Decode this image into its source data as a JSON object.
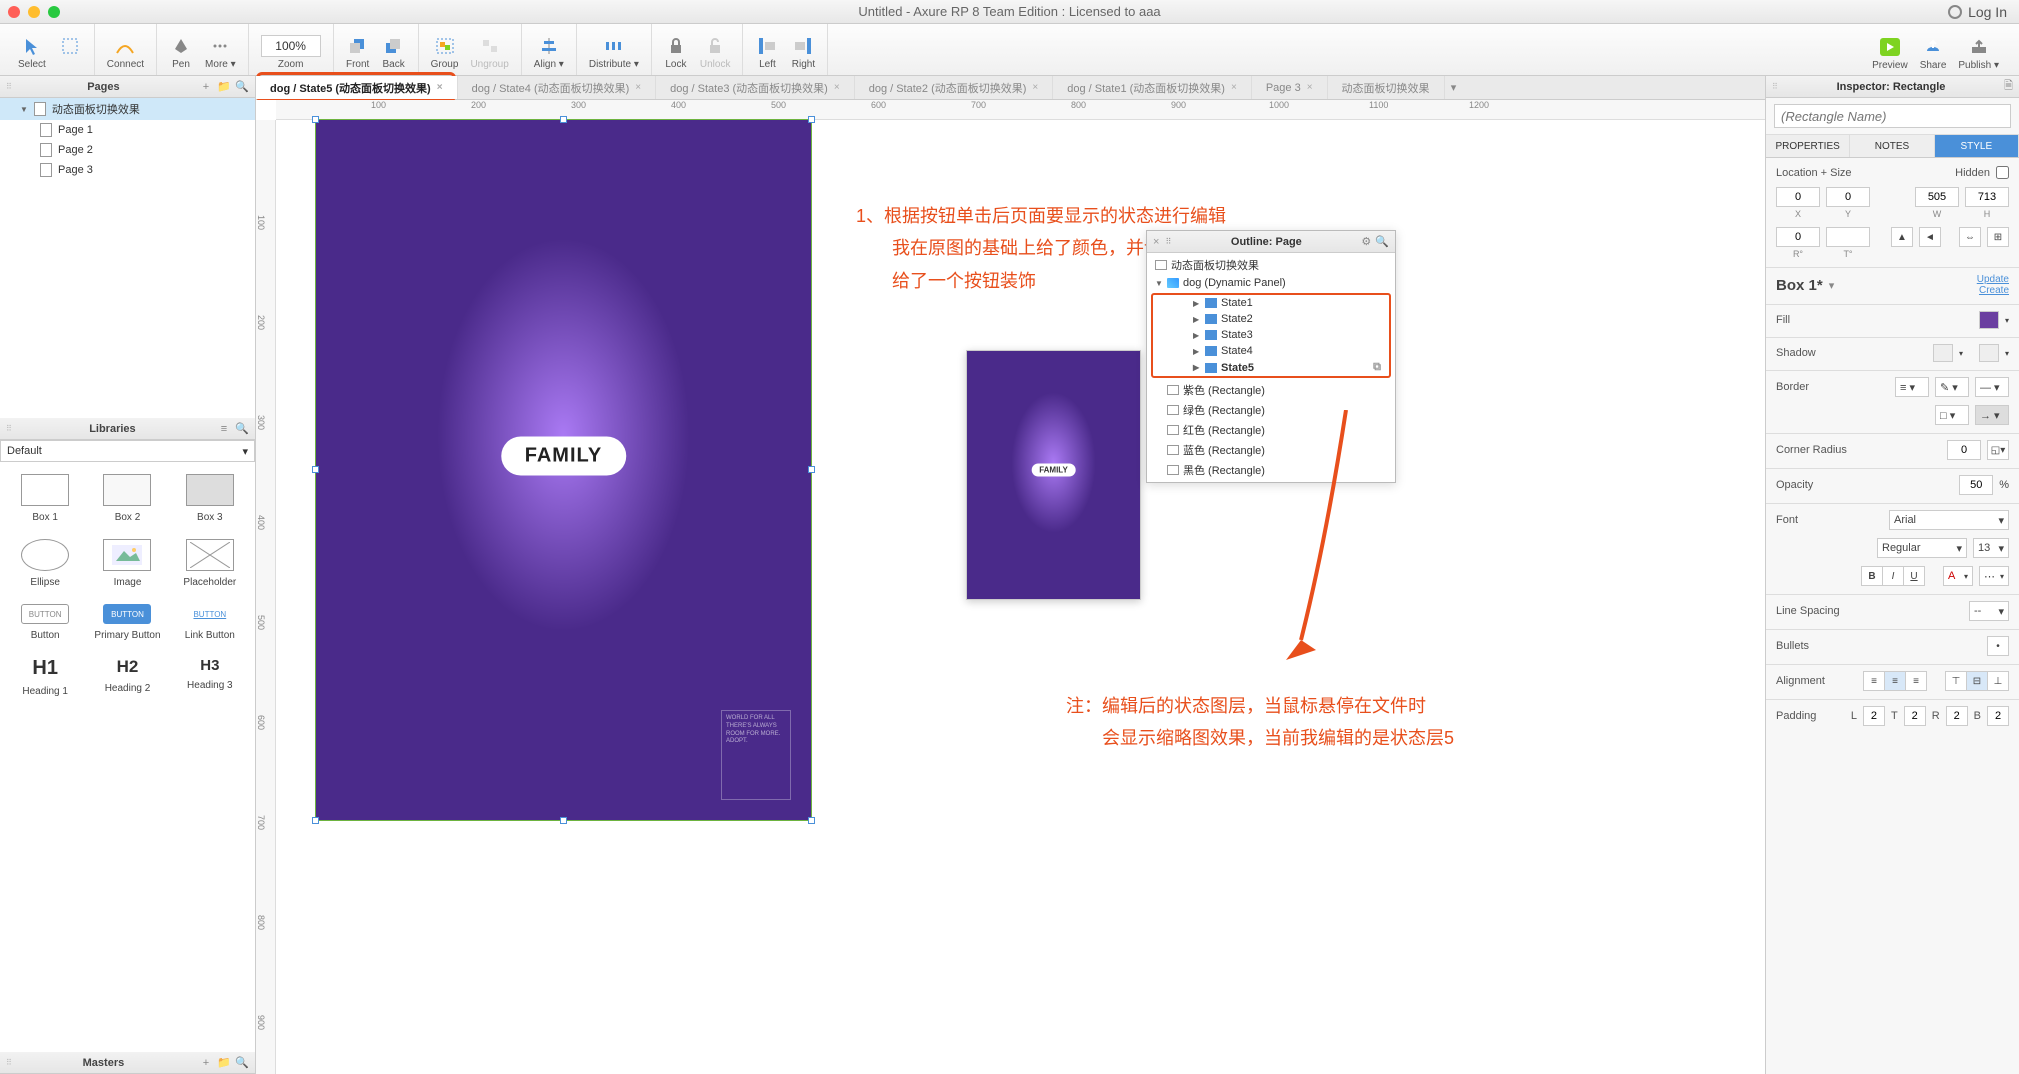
{
  "title": "Untitled - Axure RP 8 Team Edition : Licensed to aaa",
  "login": "Log In",
  "toolbar": {
    "select": "Select",
    "connect": "Connect",
    "pen": "Pen",
    "more": "More ▾",
    "zoom_val": "100%",
    "zoom": "Zoom",
    "front": "Front",
    "back": "Back",
    "group": "Group",
    "ungroup": "Ungroup",
    "align": "Align ▾",
    "distribute": "Distribute ▾",
    "lock": "Lock",
    "unlock": "Unlock",
    "left": "Left",
    "right": "Right",
    "preview": "Preview",
    "share": "Share",
    "publish": "Publish ▾"
  },
  "tabs": [
    {
      "label": "dog / State5 (动态面板切换效果)",
      "active": true
    },
    {
      "label": "dog / State4 (动态面板切换效果)"
    },
    {
      "label": "dog / State3 (动态面板切换效果)"
    },
    {
      "label": "dog / State2 (动态面板切换效果)"
    },
    {
      "label": "dog / State1 (动态面板切换效果)"
    },
    {
      "label": "Page 3"
    },
    {
      "label": "动态面板切换效果"
    }
  ],
  "pages_panel": {
    "title": "Pages",
    "items": [
      {
        "label": "动态面板切换效果",
        "sel": true
      },
      {
        "label": "Page 1",
        "child": true
      },
      {
        "label": "Page 2",
        "child": true
      },
      {
        "label": "Page 3",
        "child": true
      }
    ]
  },
  "libraries_panel": {
    "title": "Libraries",
    "select": "Default",
    "items": [
      "Box 1",
      "Box 2",
      "Box 3",
      "Ellipse",
      "Image",
      "Placeholder",
      "Button",
      "Primary Button",
      "Link Button",
      "H1\nHeading 1",
      "H2\nHeading 2",
      "H3\nHeading 3"
    ]
  },
  "masters_panel": {
    "title": "Masters"
  },
  "poster": {
    "pill": "FAMILY",
    "badge": "WORLD FOR ALL\nTHERE'S ALWAYS ROOM FOR MORE. ADOPT."
  },
  "annot1": "1、根据按钮单击后页面要显示的状态进行编辑\n　　我在原图的基础上给了颜色，并调整了透明度50%\n　　给了一个按钮装饰",
  "annot2": "注：编辑后的状态图层，当鼠标悬停在文件时\n　　会显示缩略图效果，当前我编辑的是状态层5",
  "outline": {
    "title": "Outline: Page",
    "root": "动态面板切换效果",
    "dp": "dog (Dynamic Panel)",
    "states": [
      "State1",
      "State2",
      "State3",
      "State4",
      "State5"
    ],
    "rects": [
      "紫色 (Rectangle)",
      "绿色 (Rectangle)",
      "红色 (Rectangle)",
      "蓝色 (Rectangle)",
      "黑色 (Rectangle)"
    ]
  },
  "inspector": {
    "title": "Inspector: Rectangle",
    "name_placeholder": "(Rectangle Name)",
    "tabs": [
      "PROPERTIES",
      "NOTES",
      "STYLE"
    ],
    "loc_size": "Location + Size",
    "hidden": "Hidden",
    "x": "0",
    "y": "0",
    "w": "505",
    "h": "713",
    "x_lbl": "X",
    "y_lbl": "Y",
    "w_lbl": "W",
    "h_lbl": "H",
    "rot": "0",
    "rot_lbl": "R°",
    "trot": "",
    "trot_lbl": "T°",
    "style_name": "Box 1*",
    "update": "Update",
    "create": "Create",
    "fill": "Fill",
    "fill_color": "#6b3fa0",
    "shadow": "Shadow",
    "border": "Border",
    "corner": "Corner Radius",
    "corner_val": "0",
    "opacity": "Opacity",
    "opacity_val": "50",
    "pct": "%",
    "font": "Font",
    "font_family": "Arial",
    "font_weight": "Regular",
    "font_size": "13",
    "line_spacing": "Line Spacing",
    "ls_val": "--",
    "bullets": "Bullets",
    "alignment": "Alignment",
    "padding": "Padding",
    "pL": "L",
    "pT": "T",
    "pR": "R",
    "pB": "B",
    "pL_v": "2",
    "pT_v": "2",
    "pR_v": "2",
    "pB_v": "2"
  },
  "ruler_h": [
    "100",
    "200",
    "300",
    "400",
    "500",
    "600",
    "700",
    "800",
    "900",
    "1000",
    "1100",
    "1200"
  ],
  "ruler_v": [
    "100",
    "200",
    "300",
    "400",
    "500",
    "600",
    "700",
    "800",
    "900"
  ]
}
